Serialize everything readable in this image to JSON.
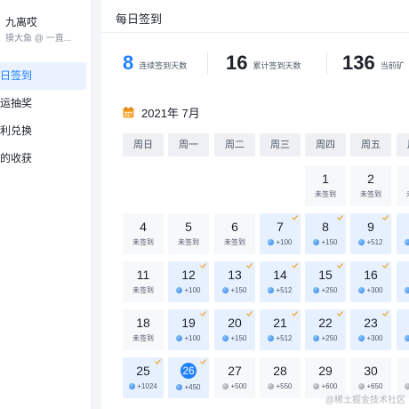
{
  "sidebar": {
    "user_name": "九离哎",
    "user_sub": "摸大鱼 @ 一直...",
    "items": [
      {
        "label": "日签到",
        "active": true
      },
      {
        "label": "运抽奖",
        "active": false
      },
      {
        "label": "利兑换",
        "active": false
      },
      {
        "label": "的收获",
        "active": false
      }
    ]
  },
  "header": {
    "title": "每日签到"
  },
  "stats": [
    {
      "value": "8",
      "label": "连续签到天数",
      "highlight": true
    },
    {
      "value": "16",
      "label": "累计签到天数",
      "highlight": false
    },
    {
      "value": "136",
      "label": "当前矿",
      "highlight": false
    }
  ],
  "calendar": {
    "month_label": "2021年 7月",
    "weekdays": [
      "周日",
      "周一",
      "周二",
      "周三",
      "周四",
      "周五",
      "周六"
    ],
    "weeks": [
      [
        null,
        null,
        null,
        null,
        {
          "day": "1",
          "text": "未签到",
          "state": "unsigned"
        },
        {
          "day": "2",
          "text": "未签到",
          "state": "unsigned"
        },
        {
          "day": "3",
          "text": "未签到",
          "state": "unsigned"
        }
      ],
      [
        {
          "day": "4",
          "text": "未签到",
          "state": "unsigned"
        },
        {
          "day": "5",
          "text": "未签到",
          "state": "unsigned"
        },
        {
          "day": "6",
          "text": "未签到",
          "state": "unsigned"
        },
        {
          "day": "7",
          "text": "+100",
          "state": "signed"
        },
        {
          "day": "8",
          "text": "+150",
          "state": "signed"
        },
        {
          "day": "9",
          "text": "+512",
          "state": "signed"
        },
        {
          "day": "10",
          "text": "+250",
          "state": "signed"
        }
      ],
      [
        {
          "day": "11",
          "text": "未签到",
          "state": "unsigned"
        },
        {
          "day": "12",
          "text": "+100",
          "state": "signed"
        },
        {
          "day": "13",
          "text": "+150",
          "state": "signed"
        },
        {
          "day": "14",
          "text": "+512",
          "state": "signed"
        },
        {
          "day": "15",
          "text": "+250",
          "state": "signed"
        },
        {
          "day": "16",
          "text": "+300",
          "state": "signed"
        },
        {
          "day": "17",
          "text": "+350",
          "state": "signed"
        }
      ],
      [
        {
          "day": "18",
          "text": "未签到",
          "state": "unsigned"
        },
        {
          "day": "19",
          "text": "+100",
          "state": "signed"
        },
        {
          "day": "20",
          "text": "+150",
          "state": "signed"
        },
        {
          "day": "21",
          "text": "+512",
          "state": "signed"
        },
        {
          "day": "22",
          "text": "+250",
          "state": "signed"
        },
        {
          "day": "23",
          "text": "+300",
          "state": "signed"
        },
        {
          "day": "24",
          "text": "+350",
          "state": "signed"
        }
      ],
      [
        {
          "day": "25",
          "text": "+1024",
          "state": "signed"
        },
        {
          "day": "26",
          "text": "+450",
          "state": "today"
        },
        {
          "day": "27",
          "text": "+500",
          "state": "future"
        },
        {
          "day": "28",
          "text": "+550",
          "state": "future"
        },
        {
          "day": "29",
          "text": "+600",
          "state": "future"
        },
        {
          "day": "30",
          "text": "+650",
          "state": "future"
        },
        {
          "day": "31",
          "text": "+700",
          "state": "future"
        }
      ]
    ]
  },
  "watermark": "@稀土掘金技术社区",
  "colors": {
    "accent": "#1e80ff",
    "signed_bg": "#e6f0ff",
    "cell_bg": "#f7f8fa",
    "check": "#f0a020"
  }
}
